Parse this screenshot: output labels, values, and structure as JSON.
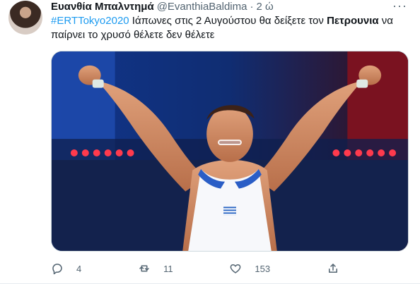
{
  "tweet": {
    "author_name": "Ευανθία Μπαλντημά",
    "author_handle": "@EvanthiaBaldima",
    "separator": "·",
    "time": "2 ώ",
    "more_label": "···",
    "text": {
      "hashtag": "#ERTTokyo2020",
      "part1": " Ιάπωνες στις 2 Αυγούστου θα δείξετε τον ",
      "highlight": "Πετρουνια",
      "part2": " να παίρνει το χρυσό θέλετε δεν θέλετε"
    },
    "actions": {
      "reply_count": "4",
      "retweet_count": "11",
      "like_count": "153"
    }
  },
  "icons": {
    "reply": "reply-icon",
    "retweet": "retweet-icon",
    "like": "like-icon",
    "share": "share-icon",
    "more": "more-icon"
  },
  "colors": {
    "hashtag": "#1d9bf0",
    "secondary_text": "#536471"
  }
}
